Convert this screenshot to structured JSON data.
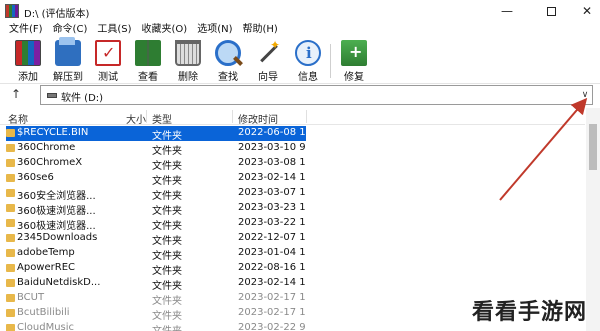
{
  "window": {
    "title": "D:\\ (评估版本)"
  },
  "menu": [
    "文件(F)",
    "命令(C)",
    "工具(S)",
    "收藏夹(O)",
    "选项(N)",
    "帮助(H)"
  ],
  "toolbar": [
    {
      "label": "添加",
      "icon": "add-icon"
    },
    {
      "label": "解压到",
      "icon": "extract-icon"
    },
    {
      "label": "测试",
      "icon": "test-icon"
    },
    {
      "label": "查看",
      "icon": "view-icon"
    },
    {
      "label": "删除",
      "icon": "delete-icon"
    },
    {
      "label": "查找",
      "icon": "find-icon"
    },
    {
      "label": "向导",
      "icon": "wizard-icon"
    },
    {
      "label": "信息",
      "icon": "info-icon"
    },
    {
      "label": "修复",
      "icon": "repair-icon"
    }
  ],
  "address": {
    "up": "↑",
    "path": "软件 (D:)",
    "dropdown": "∨"
  },
  "columns": {
    "name": "名称",
    "size": "大小",
    "type": "类型",
    "modified": "修改时间"
  },
  "rows": [
    {
      "name": "$RECYCLE.BIN",
      "type": "文件夹",
      "date": "2022-06-08 1"
    },
    {
      "name": "360Chrome",
      "type": "文件夹",
      "date": "2023-03-10 9"
    },
    {
      "name": "360ChromeX",
      "type": "文件夹",
      "date": "2023-03-08 1"
    },
    {
      "name": "360se6",
      "type": "文件夹",
      "date": "2023-02-14 1"
    },
    {
      "name": "360安全浏览器...",
      "type": "文件夹",
      "date": "2023-03-07 1"
    },
    {
      "name": "360极速浏览器...",
      "type": "文件夹",
      "date": "2023-03-23 1"
    },
    {
      "name": "360极速浏览器...",
      "type": "文件夹",
      "date": "2023-03-22 1"
    },
    {
      "name": "2345Downloads",
      "type": "文件夹",
      "date": "2022-12-07 1"
    },
    {
      "name": "adobeTemp",
      "type": "文件夹",
      "date": "2023-01-04 1"
    },
    {
      "name": "ApowerREC",
      "type": "文件夹",
      "date": "2022-08-16 1"
    },
    {
      "name": "BaiduNetdiskD...",
      "type": "文件夹",
      "date": "2023-02-14 1"
    },
    {
      "name": "BCUT",
      "type": "文件夹",
      "date": "2023-02-17 1"
    },
    {
      "name": "BcutBilibili",
      "type": "文件夹",
      "date": "2023-02-17 1"
    },
    {
      "name": "CloudMusic",
      "type": "文件夹",
      "date": "2023-02-22 9"
    }
  ],
  "watermark": "看看手游网",
  "colors": {
    "selection": "#0a64d8",
    "arrow": "#c0392b",
    "folder": "#e8b84a"
  }
}
